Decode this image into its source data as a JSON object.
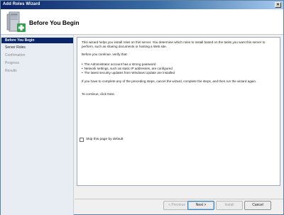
{
  "window": {
    "title": "Add Roles Wizard",
    "close_symbol": "×"
  },
  "header": {
    "page_title": "Before You Begin",
    "icon": "server-roles-wizard-icon"
  },
  "sidebar": {
    "items": [
      {
        "label": "Before You Begin",
        "state": "active"
      },
      {
        "label": "Server Roles",
        "state": "enabled"
      },
      {
        "label": "Confirmation",
        "state": "disabled"
      },
      {
        "label": "Progress",
        "state": "disabled"
      },
      {
        "label": "Results",
        "state": "disabled"
      }
    ]
  },
  "content": {
    "intro": "This wizard helps you install roles on this server. You determine which roles to install based on the tasks you want this server to perform, such as sharing documents or hosting a Web site.",
    "verify": "Before you continue, verify that:",
    "bullets": [
      "The Administrator account has a strong password",
      "Network settings, such as static IP addresses, are configured",
      "The latest security updates from Windows Update are installed"
    ],
    "cancel_note": "If you have to complete any of the preceding steps, cancel the wizard, complete the steps, and then run the wizard again.",
    "continue_note": "To continue, click Next."
  },
  "options": {
    "skip_label": "Skip this page by default",
    "skip_checked": false
  },
  "buttons": {
    "previous": "< Previous",
    "next": "Next >",
    "install": "Install",
    "cancel": "Cancel"
  },
  "colors": {
    "title_bar": "#0a246a",
    "active_nav": "#0a246a",
    "sidebar_bg": "#e8edf3"
  }
}
